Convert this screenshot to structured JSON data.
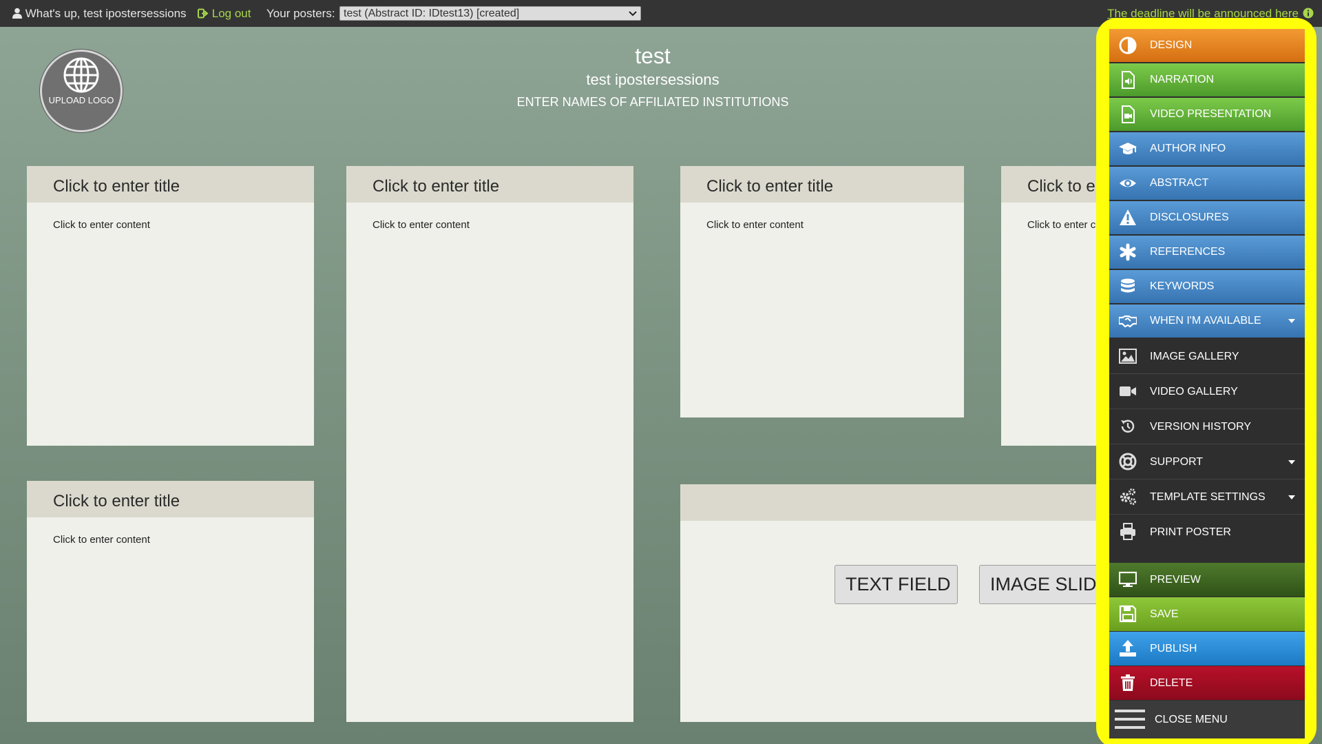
{
  "topbar": {
    "greeting": "What's up, test ipostersessions",
    "logout_label": "Log out",
    "posters_label": "Your posters:",
    "poster_selected": "test (Abstract ID: IDtest13) [created]",
    "deadline": "The deadline will be announced here"
  },
  "header": {
    "logo_label": "UPLOAD LOGO",
    "title": "test",
    "authors": "test ipostersessions",
    "institutions": "ENTER NAMES OF AFFILIATED INSTITUTIONS"
  },
  "panels": [
    {
      "title": "Click to enter title",
      "content": "Click to enter content"
    },
    {
      "title": "Click to enter title",
      "content": "Click to enter content"
    },
    {
      "title": "Click to enter title",
      "content": "Click to enter content"
    },
    {
      "title": "Click to e",
      "content": "Click to enter c"
    },
    {
      "title": "Click to enter title",
      "content": "Click to enter content"
    }
  ],
  "media_panel": {
    "text_field_label": "TEXT FIELD",
    "image_slider_label": "IMAGE SLIDI"
  },
  "menu": {
    "items": [
      {
        "label": "DESIGN",
        "icon": "contrast-icon"
      },
      {
        "label": "NARRATION",
        "icon": "audio-file-icon"
      },
      {
        "label": "VIDEO PRESENTATION",
        "icon": "video-file-icon"
      },
      {
        "label": "AUTHOR INFO",
        "icon": "graduation-cap-icon"
      },
      {
        "label": "ABSTRACT",
        "icon": "eye-icon"
      },
      {
        "label": "DISCLOSURES",
        "icon": "warning-icon"
      },
      {
        "label": "REFERENCES",
        "icon": "asterisk-icon"
      },
      {
        "label": "KEYWORDS",
        "icon": "database-icon"
      },
      {
        "label": "WHEN I'M AVAILABLE",
        "icon": "handshake-icon"
      },
      {
        "label": "IMAGE GALLERY",
        "icon": "image-icon"
      },
      {
        "label": "VIDEO GALLERY",
        "icon": "video-camera-icon"
      },
      {
        "label": "VERSION HISTORY",
        "icon": "history-icon"
      },
      {
        "label": "SUPPORT",
        "icon": "lifebuoy-icon"
      },
      {
        "label": "TEMPLATE SETTINGS",
        "icon": "gears-icon"
      },
      {
        "label": "PRINT POSTER",
        "icon": "printer-icon"
      },
      {
        "label": "PREVIEW",
        "icon": "monitor-icon"
      },
      {
        "label": "SAVE",
        "icon": "floppy-disk-icon"
      },
      {
        "label": "PUBLISH",
        "icon": "upload-icon"
      },
      {
        "label": "DELETE",
        "icon": "trash-icon"
      },
      {
        "label": "CLOSE MENU",
        "icon": "hamburger-icon"
      }
    ]
  },
  "colors": {
    "topbar_bg": "#343434",
    "link_green": "#a8d64a",
    "highlight_yellow": "#ffff0a",
    "panel_bg": "#eff0ea",
    "panel_title_bg": "#dbd9cd"
  }
}
